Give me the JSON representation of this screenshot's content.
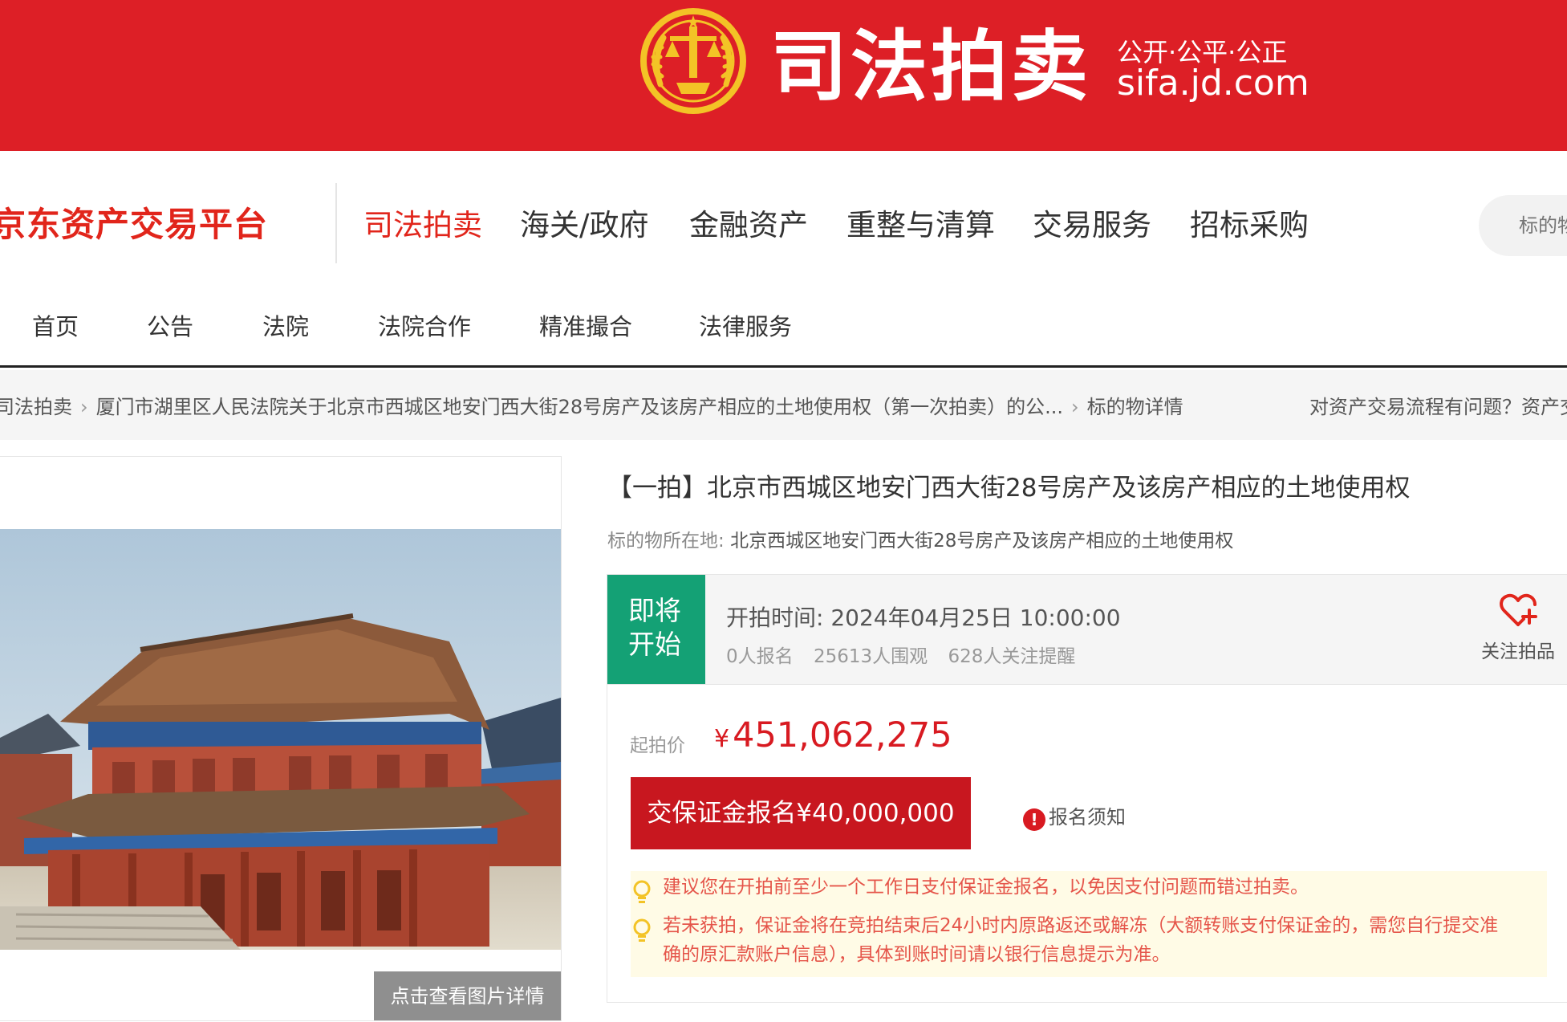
{
  "banner": {
    "seal_text": "",
    "title": "司法拍卖",
    "slogan": "公开·公平·公正",
    "domain": "sifa.jd.com"
  },
  "brand": {
    "name": "京东资产交易平台"
  },
  "main_nav": [
    {
      "label": "司法拍卖",
      "active": true
    },
    {
      "label": "海关/政府",
      "active": false
    },
    {
      "label": "金融资产",
      "active": false
    },
    {
      "label": "重整与清算",
      "active": false
    },
    {
      "label": "交易服务",
      "active": false
    },
    {
      "label": "招标采购",
      "active": false
    }
  ],
  "search": {
    "placeholder": "标的物"
  },
  "sub_nav": [
    "首页",
    "公告",
    "法院",
    "法院合作",
    "精准撮合",
    "法律服务"
  ],
  "breadcrumb": {
    "items": [
      "司法拍卖",
      "厦门市湖里区人民法院关于北京市西城区地安门西大街28号房产及该房产相应的土地使用权（第一次拍卖）的公...",
      "标的物详情"
    ],
    "help": "对资产交易流程有问题？资产交"
  },
  "gallery": {
    "view_button": "点击查看图片详情"
  },
  "item": {
    "title": "【一拍】北京市西城区地安门西大街28号房产及该房产相应的土地使用权",
    "location_label": "标的物所在地:",
    "location_value": "北京西城区地安门西大街28号房产及该房产相应的土地使用权"
  },
  "status": {
    "badge_line1": "即将",
    "badge_line2": "开始",
    "start_time_label": "开拍时间:",
    "start_time_value": "2024年04月25日 10:00:00",
    "registrations": "0人报名",
    "viewers": "25613人围观",
    "followers": "628人关注提醒",
    "follow_label": "关注拍品"
  },
  "price": {
    "label": "起拍价",
    "currency": "¥",
    "value": "451,062,275"
  },
  "deposit": {
    "button_text": "交保证金报名",
    "currency": "¥",
    "amount": "40,000,000",
    "notice_link": "报名须知"
  },
  "tips": [
    "建议您在开拍前至少一个工作日支付保证金报名，以免因支付问题而错过拍卖。",
    "若未获拍，保证金将在竞拍结束后24小时内原路返还或解冻（大额转账支付保证金的，需您自行提交准",
    "确的原汇款账户信息），具体到账时间请以银行信息提示为准。"
  ],
  "colors": {
    "banner_red": "#dd1f26",
    "brand_red": "#e1251b",
    "price_red": "#d81a21",
    "status_green": "#14a175",
    "button_red": "#c8171f",
    "tip_text": "#e5554a",
    "tip_bg": "#fffbe6"
  },
  "icons": {
    "seal": "court-seal-icon",
    "follow": "heart-plus-icon",
    "warning": "exclamation-circle-icon",
    "tip": "lightbulb-icon",
    "breadcrumb_separator": "chevron-right-icon"
  }
}
